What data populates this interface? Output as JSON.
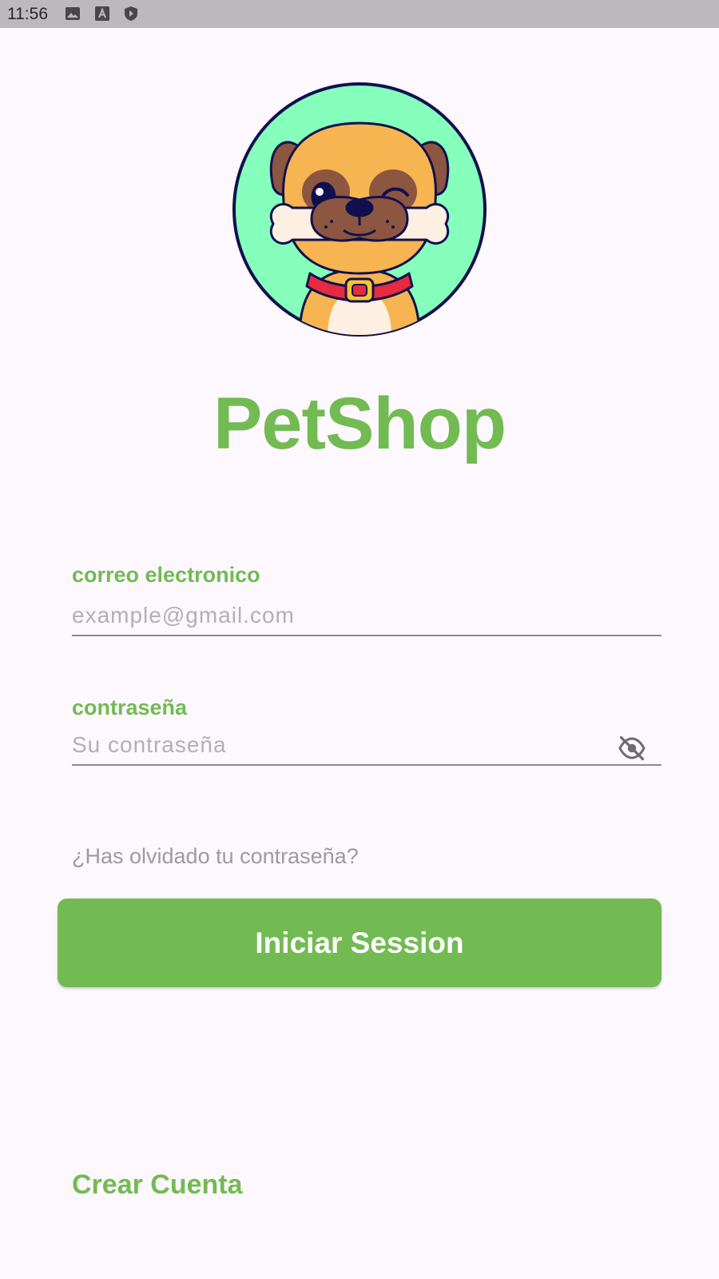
{
  "status_bar": {
    "time": "11:56",
    "icons": [
      "image-icon",
      "font-a-icon",
      "shield-play-icon"
    ]
  },
  "logo": {
    "icon": "pug-dog-logo",
    "background_color": "#85ffbb"
  },
  "app": {
    "title": "PetShop"
  },
  "email": {
    "label": "correo electronico",
    "placeholder": "example@gmail.com",
    "value": ""
  },
  "password": {
    "label": "contraseña",
    "placeholder": "Su contraseña",
    "value": "",
    "toggle_icon": "eye-off-icon"
  },
  "forgot_password": {
    "label": "¿Has olvidado tu contraseña?"
  },
  "login_button": {
    "label": "Iniciar Session"
  },
  "create_account": {
    "label": "Crear Cuenta"
  },
  "colors": {
    "accent": "#72bb52",
    "background": "#fdf7fe",
    "status_bar": "#bdb7be",
    "muted_text": "#9e9aa0"
  }
}
